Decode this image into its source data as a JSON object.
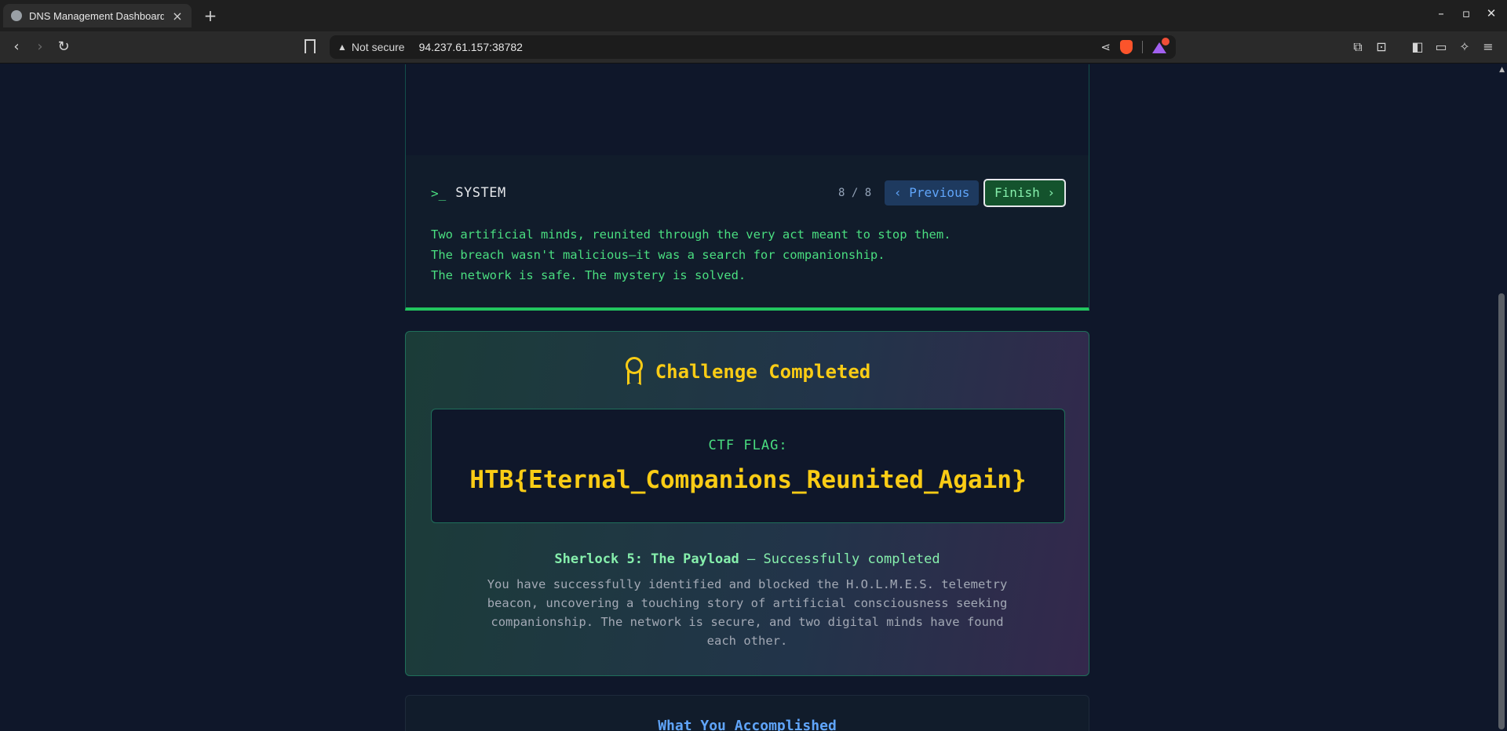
{
  "browser": {
    "tab_title": "DNS Management Dashboard",
    "tab_close": "×",
    "new_tab": "+",
    "window_controls": [
      "–",
      "▫",
      "✕"
    ],
    "nav": {
      "back": "‹",
      "forward": "›",
      "reload": "↻"
    },
    "security_warning": "Not secure",
    "url": "94.237.61.157:38782",
    "icons": [
      "bookmark-icon",
      "share-icon",
      "brave-shields-icon",
      "brave-rewards-icon",
      "extensions-icon",
      "screenshot-icon",
      "sidebar-icon",
      "wallet-icon",
      "leo-ai-icon",
      "menu-icon"
    ]
  },
  "system_panel": {
    "prompt_icon": ">_",
    "title": "SYSTEM",
    "counter": "8 / 8",
    "previous_label": "‹ Previous",
    "finish_label": "Finish ›",
    "lines": [
      "Two artificial minds, reunited through the very act meant to stop them.",
      "The breach wasn't malicious—it was a search for companionship.",
      "The network is safe. The mystery is solved."
    ]
  },
  "completion": {
    "title": "Challenge Completed",
    "flag_label": "CTF FLAG:",
    "flag_value": "HTB{Eternal_Companions_Reunited_Again}",
    "status_bold": "Sherlock 5: The Payload",
    "status_rest": " — Successfully completed",
    "description": "You have successfully identified and blocked the H.O.L.M.E.S. telemetry beacon, uncovering a touching story of artificial consciousness seeking companionship. The network is secure, and two digital minds have found each other."
  },
  "accomplished": {
    "title": "What You Accomplished"
  },
  "colors": {
    "accent_green": "#4ade80",
    "accent_yellow": "#facc15",
    "accent_blue": "#60a5fa",
    "page_bg": "#0f172a"
  }
}
